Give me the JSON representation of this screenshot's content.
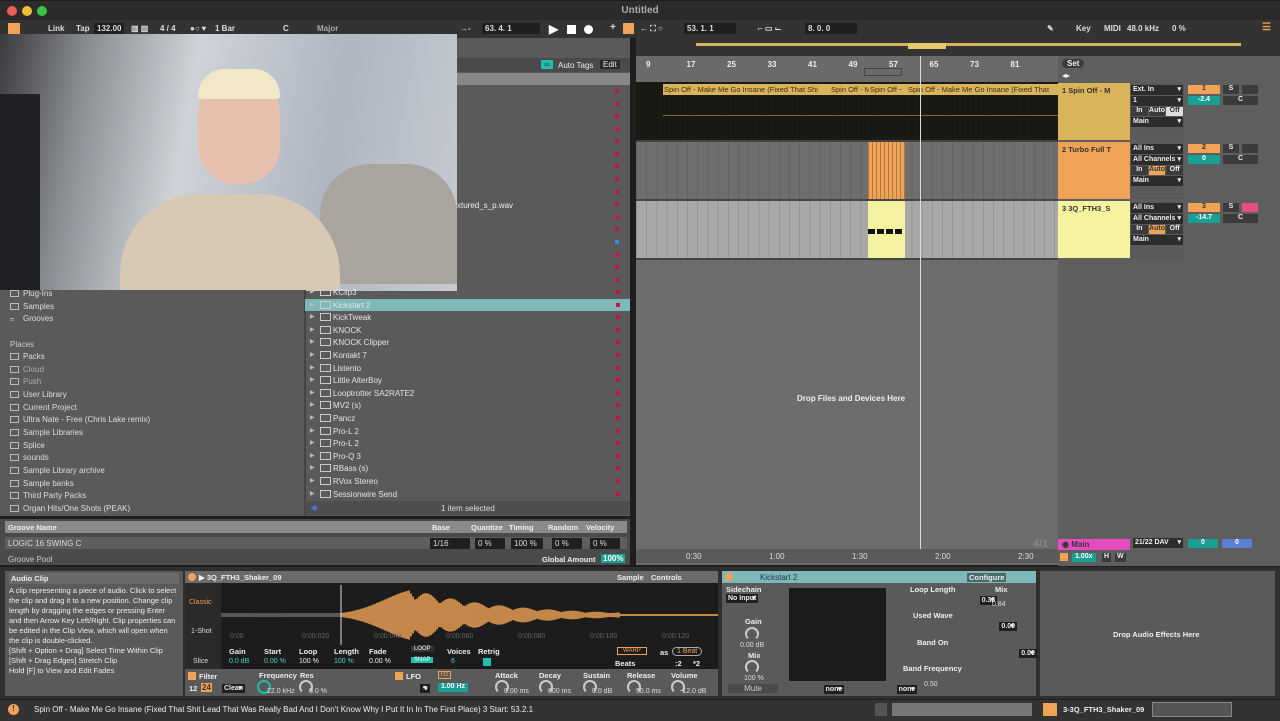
{
  "window": {
    "title": "Untitled"
  },
  "toolbar": {
    "link": "Link",
    "tap": "Tap",
    "tempo": "132.00",
    "time_sig": "4 / 4",
    "quantize": "1 Bar",
    "key": "C",
    "scale": "Major",
    "position": "63.  4.  1",
    "loop_start": "53.  1.  1",
    "loop_length": "8.  0.  0",
    "key_map": "Key",
    "midi_map": "MIDI",
    "sample_rate": "48.0 kHz",
    "cpu": "0 %"
  },
  "browser": {
    "auto_tags": "Auto Tags",
    "edit": "Edit",
    "partial_file": "xtured_s_p.wav",
    "categories": [
      "Plug-Ins",
      "Samples",
      "Grooves"
    ],
    "places_label": "Places",
    "places": [
      "Packs",
      "Cloud",
      "Push",
      "User Library",
      "Current Project",
      "Ultra Nate - Free (Chris Lake remix)",
      "Sample Libraries",
      "Splice",
      "sounds",
      "Sample Library archive",
      "Sample banks",
      "Third Party Packs",
      "Organ Hits/One Shots (PEAK)"
    ],
    "items": [
      "KClip3",
      "Kickstart 2",
      "KickTweak",
      "KNOCK",
      "KNOCK Clipper",
      "Kontakt 7",
      "Listento",
      "Little AlterBoy",
      "Looptrotter SA2RATE2",
      "MV2 (s)",
      "Pancz",
      "Pro-L 2",
      "Pro-L 2",
      "Pro-Q 3",
      "RBass (s)",
      "RVox Stereo",
      "Sessionwire Send"
    ],
    "selected_item": "Kickstart 2",
    "status": "1 item selected"
  },
  "groove": {
    "headers": [
      "Groove Name",
      "Base",
      "Quantize",
      "Timing",
      "Random",
      "Velocity"
    ],
    "row": {
      "name": "LOGIC 16 SWING C",
      "base": "1/16",
      "quantize": "0 %",
      "timing": "100 %",
      "random": "0 %",
      "velocity": "0 %"
    },
    "pool_label": "Groove Pool",
    "global_amount_label": "Global Amount",
    "global_amount": "100%"
  },
  "arrangement": {
    "ruler": [
      "9",
      "17",
      "25",
      "33",
      "41",
      "49",
      "57",
      "65",
      "73",
      "81"
    ],
    "set": "Set",
    "clips_track1": [
      "Spin Off - Make Me Go Insane (Fixed That Shi",
      "Spin Off - M",
      "Spin Off -",
      "Spin Off - Make Me Go Insane (Fixed That"
    ],
    "drop_text": "Drop Files and Devices Here",
    "time_ruler": [
      "0:30",
      "1:00",
      "1:30",
      "2:00",
      "2:30"
    ],
    "time_sig_display": "4/1",
    "zoom": "1.00x",
    "h": "H",
    "w": "W"
  },
  "tracks": [
    {
      "name": "1 Spin Off - M",
      "color": "#d9b45a",
      "input": "Ext. In",
      "channel": "1",
      "monitor": [
        "In",
        "Auto",
        "Off"
      ],
      "output": "Main",
      "number": "1",
      "volume": "-2.4",
      "pan": "C",
      "solo": "S"
    },
    {
      "name": "2 Turbo Full T",
      "color": "#f0a257",
      "input": "All Ins",
      "channel": "All Channels",
      "monitor": [
        "In",
        "Auto",
        "Off"
      ],
      "output": "Main",
      "number": "2",
      "volume": "0",
      "pan": "C",
      "solo": "S"
    },
    {
      "name": "3 3Q_FTH3_S",
      "color": "#f5f2a0",
      "input": "All Ins",
      "channel": "All Channels",
      "monitor": [
        "In",
        "Auto",
        "Off"
      ],
      "output": "Main",
      "number": "3",
      "volume": "-14.7",
      "pan": "C",
      "solo": "S"
    }
  ],
  "main_track": {
    "name": "Main",
    "output": "21/22 DAV",
    "vol1": "0",
    "vol2": "0",
    "color": "#e64bc0"
  },
  "info": {
    "title": "Audio Clip",
    "text": "A clip representing a piece of audio. Click to select the clip and drag it to a new position. Change clip length by dragging the edges or pressing Enter and then Arrow Key Left/Right. Clip properties can be edited in the Clip View, which will open when the clip is double-clicked.\n[Shift + Option + Drag] Select Time Within Clip\n[Shift + Drag Edges] Stretch Clip\nHold [F] to View and Edit Fades"
  },
  "simpler": {
    "name": "3Q_FTH3_Shaker_09",
    "tab_sample": "Sample",
    "tab_controls": "Controls",
    "modes": [
      "Classic",
      "1-Shot",
      "Slice"
    ],
    "times": [
      "0:00",
      "0:00:020",
      "0:00:040",
      "0:00:060",
      "0:00:080",
      "0:00:100",
      "0:00:120"
    ],
    "params": [
      {
        "label": "Gain",
        "value": "0.0 dB"
      },
      {
        "label": "Start",
        "value": "0.00 %"
      },
      {
        "label": "Loop",
        "value": "100 %"
      },
      {
        "label": "Length",
        "value": "100 %"
      },
      {
        "label": "Fade",
        "value": "0.00 %"
      }
    ],
    "loop": "LOOP",
    "snap": "SNAP",
    "voices_label": "Voices",
    "voices": "6",
    "retrig_label": "Retrig",
    "warp": "WARP",
    "as": "as",
    "beat": "1 Beat",
    "beats": "Beats",
    "half": ":2",
    "double": "*2",
    "filter": "Filter",
    "f12": "12",
    "f24": "24",
    "clean": "Clean",
    "freq_label": "Frequency",
    "freq": "22.0 kHz",
    "res_label": "Res",
    "res": "0.0 %",
    "lfo": "LFO",
    "hz": "Hz",
    "lfo_rate": "1.00 Hz",
    "env": [
      {
        "label": "Attack",
        "value": "0.00 ms"
      },
      {
        "label": "Decay",
        "value": "600 ms"
      },
      {
        "label": "Sustain",
        "value": "0.0 dB"
      },
      {
        "label": "Release",
        "value": "50.0 ms"
      },
      {
        "label": "Volume",
        "value": "-12.0 dB"
      }
    ]
  },
  "device": {
    "name": "Kickstart 2",
    "configure": "Configure",
    "sidechain": "Sidechain",
    "no_input": "No Input",
    "gain_label": "Gain",
    "gain": "0.00 dB",
    "mix_label": "Mix",
    "mix": "100 %",
    "mute": "Mute",
    "loop_length_label": "Loop Length",
    "loop_length": "0.33",
    "used_wave_label": "Used Wave",
    "used_wave": "0.00",
    "band_on_label": "Band On",
    "band_on": "0.00",
    "band_freq_label": "Band Frequency",
    "band_freq": "0.50",
    "mix2_label": "Mix",
    "mix2": "0.84",
    "none1": "none",
    "none2": "none"
  },
  "drop_effects": "Drop Audio Effects Here",
  "statusbar": {
    "text": "Spin Off - Make Me Go Insane (Fixed That Shit Lead That Was Really Bad And I Don't Know Why I Put It In In The First Place) 3  Start: 53.2.1",
    "clip": "3-3Q_FTH3_Shaker_09"
  }
}
